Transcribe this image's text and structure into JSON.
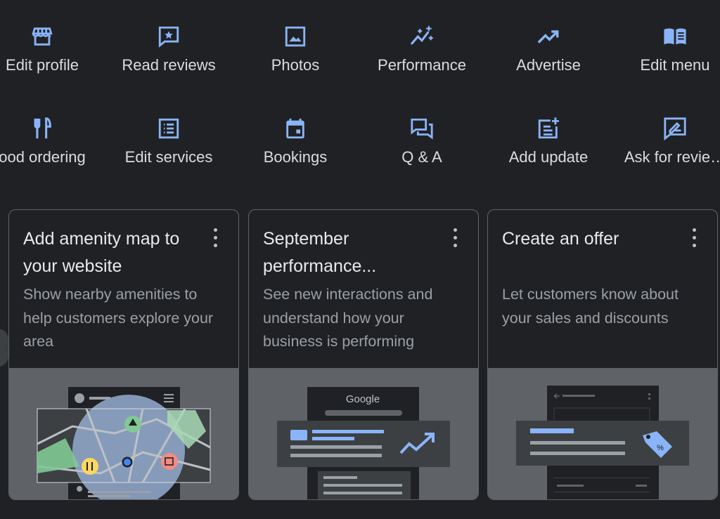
{
  "quick_actions": [
    {
      "label": "Edit profile",
      "icon": "storefront-icon"
    },
    {
      "label": "Read reviews",
      "icon": "star-comment-icon"
    },
    {
      "label": "Photos",
      "icon": "photo-icon"
    },
    {
      "label": "Performance",
      "icon": "sparkle-trend-icon"
    },
    {
      "label": "Advertise",
      "icon": "trending-up-icon"
    },
    {
      "label": "Edit menu",
      "icon": "menu-book-icon"
    },
    {
      "label": "ood ordering",
      "icon": "restaurant-icon"
    },
    {
      "label": "Edit services",
      "icon": "list-icon"
    },
    {
      "label": "Bookings",
      "icon": "calendar-icon"
    },
    {
      "label": "Q & A",
      "icon": "forum-icon"
    },
    {
      "label": "Add update",
      "icon": "post-add-icon"
    },
    {
      "label": "Ask for revie…",
      "icon": "rate-review-icon"
    }
  ],
  "cards": [
    {
      "title": "Add amenity map to your website",
      "description": "Show nearby amenities to help customers explore your area"
    },
    {
      "title": "September performance...",
      "description": "See new interactions and understand how your business is performing",
      "illustration_brand": "Google"
    },
    {
      "title": "Create an offer",
      "description": "Let customers know about your sales and discounts"
    }
  ],
  "colors": {
    "background": "#202124",
    "icon_accent": "#8ab4f8",
    "card_border": "#5f6368",
    "muted_text": "#9aa0a6"
  }
}
